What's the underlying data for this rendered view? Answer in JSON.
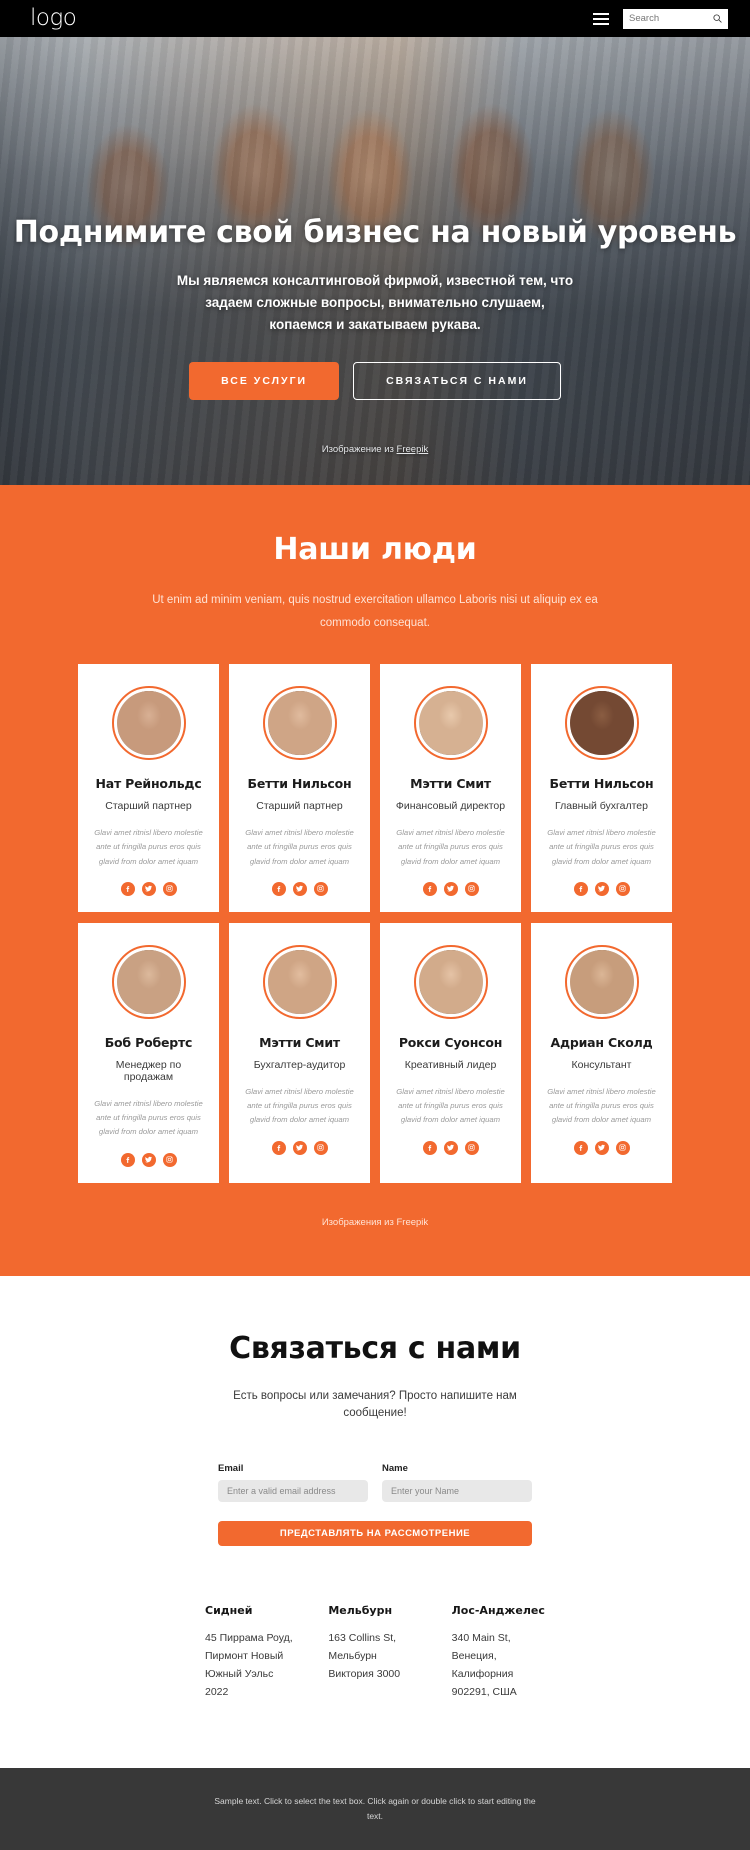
{
  "header": {
    "logo": "logo",
    "menu_icon": "hamburger-icon",
    "search_placeholder": "Search",
    "search_value": ""
  },
  "hero": {
    "title": "Поднимите свой бизнес на новый уровень",
    "subtitle": "Мы являемся консалтинговой фирмой, известной тем, что задаем сложные вопросы, внимательно слушаем, копаемся и закатываем рукава.",
    "primary_button": "ВСЕ УСЛУГИ",
    "secondary_button": "СВЯЗАТЬСЯ С НАМИ",
    "credit_prefix": "Изображение из ",
    "credit_link": "Freepik"
  },
  "team": {
    "title": "Наши люди",
    "subtitle": "Ut enim ad minim veniam, quis nostrud exercitation ullamco Laboris nisi ut aliquip ex ea commodo consequat.",
    "credit": "Изображения из Freepik",
    "description": "Glavi amet ritnisl libero molestie ante ut fringilla purus eros quis glavid from dolor amet iquam",
    "social_icons": [
      "facebook-icon",
      "twitter-icon",
      "instagram-icon"
    ],
    "members": [
      {
        "name": "Нат Рейнольдс",
        "role": "Старший партнер",
        "desc": "Glavi amet ritnisl libero molestie ante ut fringilla purus eros quis glavid from dolor amet iquam"
      },
      {
        "name": "Бетти Нильсон",
        "role": "Старший партнер",
        "desc": "Glavi amet ritnisl libero molestie ante ut fringilla purus eros quis glavid from dolor amet iquam"
      },
      {
        "name": "Мэтти Смит",
        "role": "Финансовый директор",
        "desc": "Glavi amet ritnisl libero molestie ante ut fringilla purus eros quis glavid from dolor amet iquam"
      },
      {
        "name": "Бетти Нильсон",
        "role": "Главный бухгалтер",
        "desc": "Glavi amet ritnisl libero molestie ante ut fringilla purus eros quis glavid from dolor amet iquam"
      },
      {
        "name": "Боб Робертс",
        "role": "Менеджер по продажам",
        "desc": "Glavi amet ritnisl libero molestie ante ut fringilla purus eros quis glavid from dolor amet iquam"
      },
      {
        "name": "Мэтти Смит",
        "role": "Бухгалтер-аудитор",
        "desc": "Glavi amet ritnisl libero molestie ante ut fringilla purus eros quis glavid from dolor amet iquam"
      },
      {
        "name": "Рокси Суонсон",
        "role": "Креативный лидер",
        "desc": "Glavi amet ritnisl libero molestie ante ut fringilla purus eros quis glavid from dolor amet iquam"
      },
      {
        "name": "Адриан Сколд",
        "role": "Консультант",
        "desc": "Glavi amet ritnisl libero molestie ante ut fringilla purus eros quis glavid from dolor amet iquam"
      }
    ]
  },
  "contact": {
    "title": "Связаться с нами",
    "subtitle": "Есть вопросы или замечания? Просто напишите нам сообщение!",
    "email_label": "Email",
    "email_placeholder": "Enter a valid email address",
    "email_value": "",
    "name_label": "Name",
    "name_placeholder": "Enter your Name",
    "name_value": "",
    "submit_label": "ПРЕДСТАВЛЯТЬ НА РАССМОТРЕНИЕ",
    "addresses": [
      {
        "city": "Сидней",
        "lines": "45 Пиррама Роуд, Пирмонт Новый Южный Уэльс 2022"
      },
      {
        "city": "Мельбурн",
        "lines": "163 Collins St, Мельбурн Виктория 3000"
      },
      {
        "city": "Лос-Анджелес",
        "lines": "340 Main St, Венеция, Калифорния 902291, США"
      }
    ]
  },
  "footer": {
    "text": "Sample text. Click to select the text box. Click again or double click to start editing the text."
  },
  "colors": {
    "accent": "#f2692f",
    "header_bg": "#000000",
    "footer_bg": "#383838"
  }
}
